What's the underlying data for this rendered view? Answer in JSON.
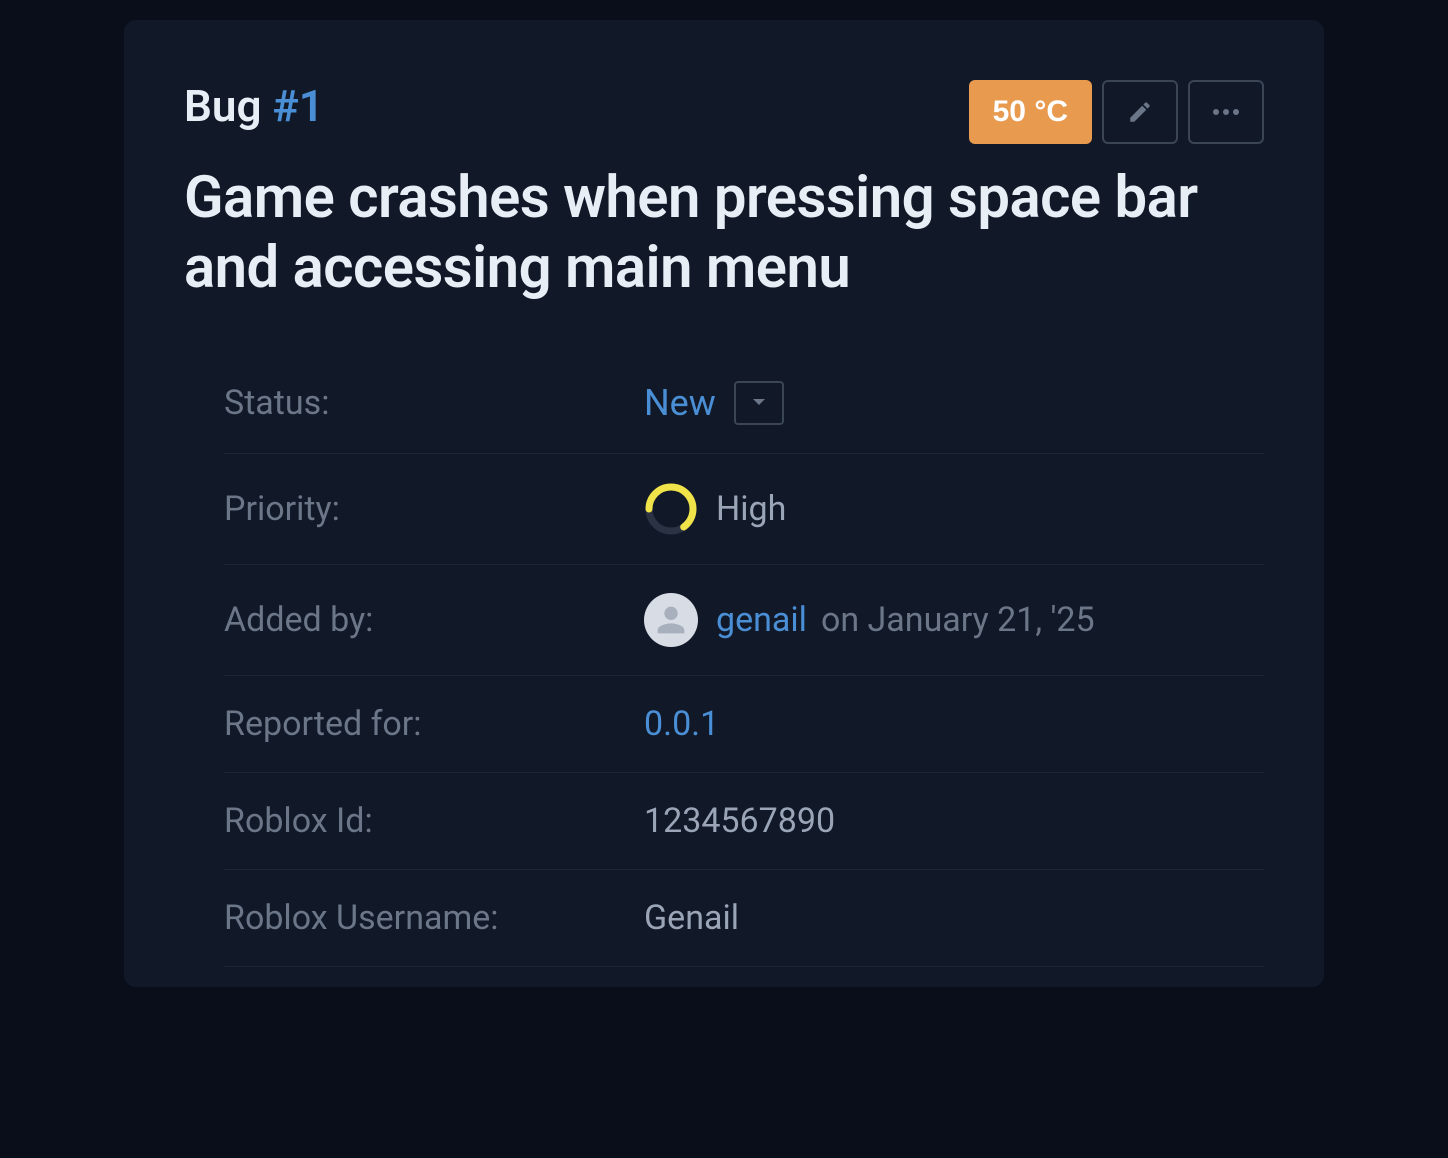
{
  "header": {
    "bug_prefix": "Bug ",
    "bug_number": "#1",
    "temperature": "50 °C"
  },
  "title": "Game crashes when pressing space bar and accessing main menu",
  "fields": {
    "status": {
      "label": "Status:",
      "value": "New"
    },
    "priority": {
      "label": "Priority:",
      "value": "High"
    },
    "added_by": {
      "label": "Added by:",
      "user": "genail",
      "date": "on January 21, '25"
    },
    "reported_for": {
      "label": "Reported for:",
      "value": "0.0.1"
    },
    "roblox_id": {
      "label": "Roblox Id:",
      "value": "1234567890"
    },
    "roblox_username": {
      "label": "Roblox Username:",
      "value": "Genail"
    }
  }
}
